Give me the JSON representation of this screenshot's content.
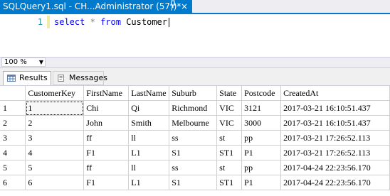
{
  "document_tab": {
    "title": "SQLQuery1.sql - CH...Administrator (57))*",
    "pin_icon": "pin-icon",
    "close_glyph": "×"
  },
  "editor": {
    "line_number": "1",
    "code": {
      "kw_select": "select",
      "star": "*",
      "kw_from": "from",
      "table": "Customer"
    }
  },
  "zoom": {
    "value": "100 %"
  },
  "results_tabs": [
    {
      "label": "Results",
      "icon": "grid-icon"
    },
    {
      "label": "Messages",
      "icon": "messages-icon"
    }
  ],
  "grid": {
    "columns": [
      "CustomerKey",
      "FirstName",
      "LastName",
      "Suburb",
      "State",
      "Postcode",
      "CreatedAt"
    ],
    "rows": [
      {
        "n": "1",
        "cells": [
          "1",
          "Chi",
          "Qi",
          "Richmond",
          "VIC",
          "3121",
          "2017-03-21 16:10:51.437"
        ]
      },
      {
        "n": "2",
        "cells": [
          "2",
          "John",
          "Smith",
          "Melbourne",
          "VIC",
          "3000",
          "2017-03-21 16:10:51.437"
        ]
      },
      {
        "n": "3",
        "cells": [
          "3",
          "ff",
          "ll",
          "ss",
          "st",
          "pp",
          "2017-03-21 17:26:52.113"
        ]
      },
      {
        "n": "4",
        "cells": [
          "4",
          "F1",
          "L1",
          "S1",
          "ST1",
          "P1",
          "2017-03-21 17:26:52.113"
        ]
      },
      {
        "n": "5",
        "cells": [
          "5",
          "ff",
          "ll",
          "ss",
          "st",
          "pp",
          "2017-04-24 22:23:56.170"
        ]
      },
      {
        "n": "6",
        "cells": [
          "6",
          "F1",
          "L1",
          "S1",
          "ST1",
          "P1",
          "2017-04-24 22:23:56.170"
        ]
      }
    ]
  },
  "colors": {
    "tab_active": "#007acc",
    "keyword": "#0000ff",
    "line_number": "#2b91af"
  }
}
